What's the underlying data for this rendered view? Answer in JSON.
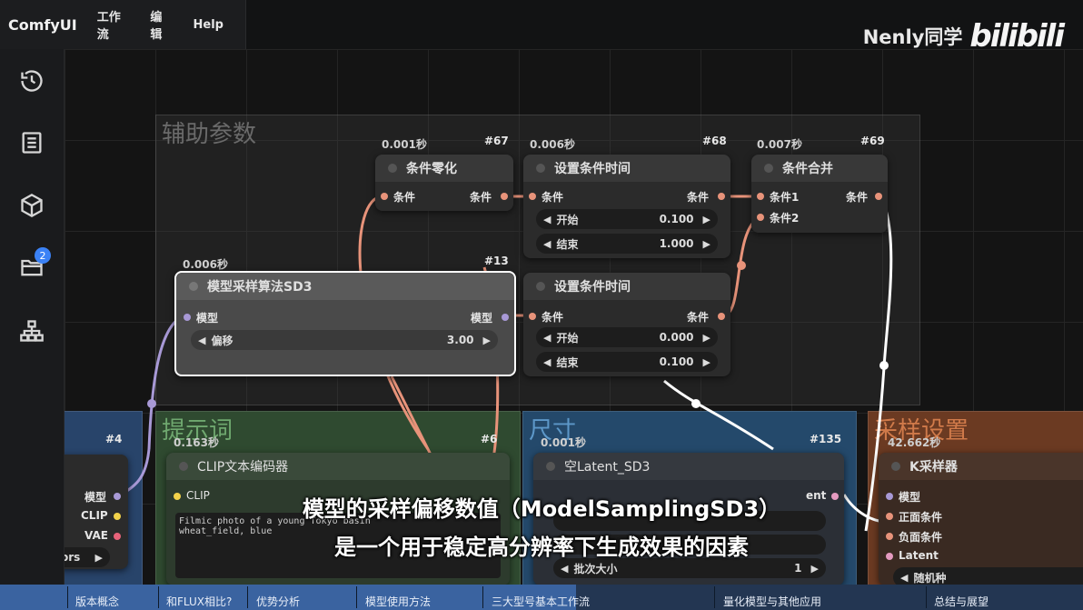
{
  "menubar": {
    "brand": "ComfyUI",
    "items": [
      "工作流",
      "编辑",
      "Help"
    ]
  },
  "watermark": {
    "name": "Nenly同学",
    "logo": "bilibili"
  },
  "sidebar": {
    "badge": "2",
    "icons": [
      "history-icon",
      "list-icon",
      "cube-icon",
      "folder-icon",
      "network-icon"
    ]
  },
  "groups": {
    "aux": "辅助参数",
    "prompt": "提示词",
    "size": "尺寸",
    "sampling": "采样设置"
  },
  "nodes": {
    "n67": {
      "time": "0.001秒",
      "id": "#67",
      "title": "条件零化",
      "in": "条件",
      "out": "条件"
    },
    "n68": {
      "time": "0.006秒",
      "id": "#68",
      "title": "设置条件时间",
      "in": "条件",
      "out": "条件",
      "w1_name": "开始",
      "w1_val": "0.100",
      "w2_name": "结束",
      "w2_val": "1.000"
    },
    "n69": {
      "time": "0.007秒",
      "id": "#69",
      "title": "条件合并",
      "in1": "条件1",
      "in2": "条件2",
      "out": "条件"
    },
    "n13": {
      "time": "0.006秒",
      "id": "#13",
      "title": "模型采样算法SD3",
      "in": "模型",
      "out": "模型",
      "w_name": "偏移",
      "w_val": "3.00"
    },
    "n68b": {
      "title": "设置条件时间",
      "in": "条件",
      "out": "条件",
      "w1_name": "开始",
      "w1_val": "0.000",
      "w2_name": "结束",
      "w2_val": "0.100"
    },
    "n4": {
      "id": "#4",
      "out1": "模型",
      "out2": "CLIP",
      "out3": "VAE",
      "frag": "ors"
    },
    "n6": {
      "time": "0.163秒",
      "id": "#6",
      "title": "CLIP文本编码器",
      "in": "CLIP",
      "text1": "Filmic photo of a young  Tokyo  basin",
      "text2": "wheat_field, blue"
    },
    "n135": {
      "time": "0.001秒",
      "id": "#135",
      "title": "空Latent_SD3",
      "out_frag": "ent",
      "w_frag": "批次大小",
      "w_val_frag": "1"
    },
    "k": {
      "time": "42.662秒",
      "title": "K采样器",
      "in1": "模型",
      "in2": "正面条件",
      "in3": "负面条件",
      "in4": "Latent",
      "w": "随机种"
    }
  },
  "subtitle": {
    "line1": "模型的采样偏移数值（ModelSamplingSD3）",
    "line2": "是一个用于稳定高分辨率下生成效果的因素"
  },
  "chapters": [
    "版本概念",
    "和FLUX相比?",
    "优势分析",
    "模型使用方法",
    "三大型号基本工作流",
    "量化模型与其他应用",
    "总结与展望"
  ],
  "colors": {
    "accent_progress": "#3a63a0",
    "chapter_bg": "#233652",
    "wire_orange": "#e8937a",
    "wire_purple": "#a899d6",
    "wire_white": "#ffffff"
  }
}
